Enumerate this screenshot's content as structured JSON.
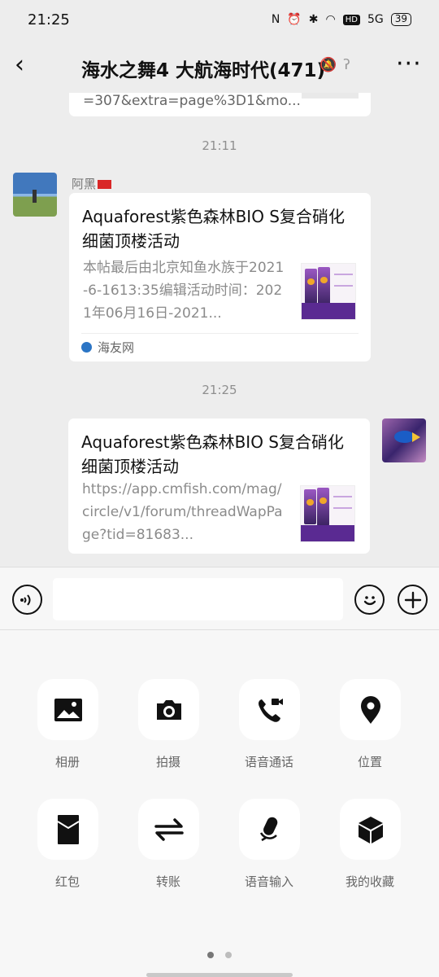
{
  "status": {
    "time": "21:25",
    "network": "5G",
    "hd": "HD",
    "battery": "39"
  },
  "header": {
    "title": "海水之舞4 大航海时代(471)"
  },
  "messages": {
    "partial_text": "=307&extra=page%3D1&mo...",
    "time1": "21:11",
    "sender_name": "阿黑",
    "card1": {
      "title": "Aquaforest紫色森林BIO S复合硝化细菌顶楼活动",
      "description": "本帖最后由北京知鱼水族于2021-6-1613:35编辑活动时间：2021年06月16日-2021...",
      "site": "海友网"
    },
    "time2": "21:25",
    "card2": {
      "title": "Aquaforest紫色森林BIO S复合硝化细菌顶楼活动",
      "url": "https://app.cmfish.com/mag/circle/v1/forum/threadWapPage?tid=81683..."
    }
  },
  "input": {
    "placeholder": ""
  },
  "tools": [
    {
      "label": "相册",
      "icon": "photo-album-icon"
    },
    {
      "label": "拍摄",
      "icon": "camera-icon"
    },
    {
      "label": "语音通话",
      "icon": "video-call-icon"
    },
    {
      "label": "位置",
      "icon": "location-icon"
    },
    {
      "label": "红包",
      "icon": "red-packet-icon"
    },
    {
      "label": "转账",
      "icon": "transfer-icon"
    },
    {
      "label": "语音输入",
      "icon": "voice-input-icon"
    },
    {
      "label": "我的收藏",
      "icon": "favorites-icon"
    }
  ],
  "colors": {
    "background": "#ededed",
    "card": "#ffffff",
    "muted_text": "#8b8b8b"
  }
}
